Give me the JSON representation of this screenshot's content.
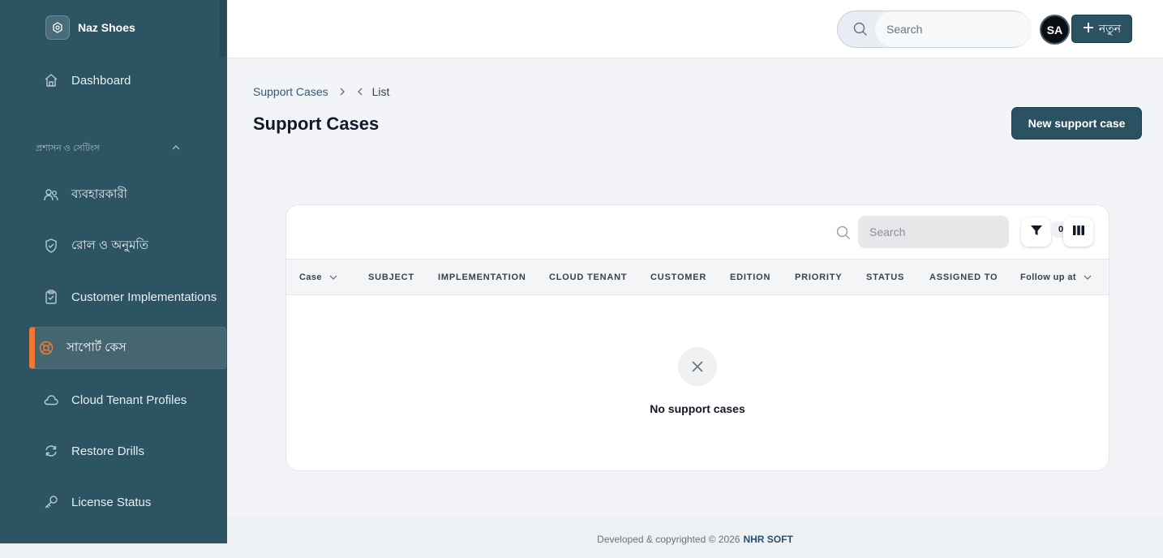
{
  "app": {
    "brand_name": "Naz Shoes"
  },
  "sidebar": {
    "section_title": "প্রশাসন ও সেটিংস",
    "items": [
      {
        "label": "Dashboard",
        "icon": "home-icon"
      },
      {
        "label": "ব্যবহারকারী",
        "icon": "users-icon"
      },
      {
        "label": "রোল ও অনুমতি",
        "icon": "shield-check-icon"
      },
      {
        "label": "Customer Implementations",
        "icon": "clipboard-check-icon"
      },
      {
        "label": "সাপোর্ট কেস",
        "icon": "lifebuoy-icon",
        "active": true
      },
      {
        "label": "Cloud Tenant Profiles",
        "icon": "cloud-icon"
      },
      {
        "label": "Restore Drills",
        "icon": "refresh-icon"
      },
      {
        "label": "License Status",
        "icon": "key-icon"
      }
    ],
    "active_accent": "#f07a35"
  },
  "topbar": {
    "search_placeholder": "Search",
    "avatar_initials": "SA",
    "new_button_label": "নতুন"
  },
  "breadcrumb": {
    "parent": "Support Cases",
    "current": "List"
  },
  "page": {
    "title": "Support Cases",
    "primary_action": "New support case"
  },
  "table": {
    "search_placeholder": "Search",
    "filter_count": "0",
    "columns": [
      "Case",
      "SUBJECT",
      "IMPLEMENTATION",
      "CLOUD TENANT",
      "CUSTOMER",
      "EDITION",
      "PRIORITY",
      "STATUS",
      "ASSIGNED TO",
      "Follow up at"
    ],
    "empty_message": "No support cases"
  },
  "footer": {
    "text": "Developed & copyrighted © 2026",
    "company": "NHR SOFT"
  },
  "colors": {
    "sidebar_bg": "#2d5463",
    "primary": "#2b5262"
  }
}
